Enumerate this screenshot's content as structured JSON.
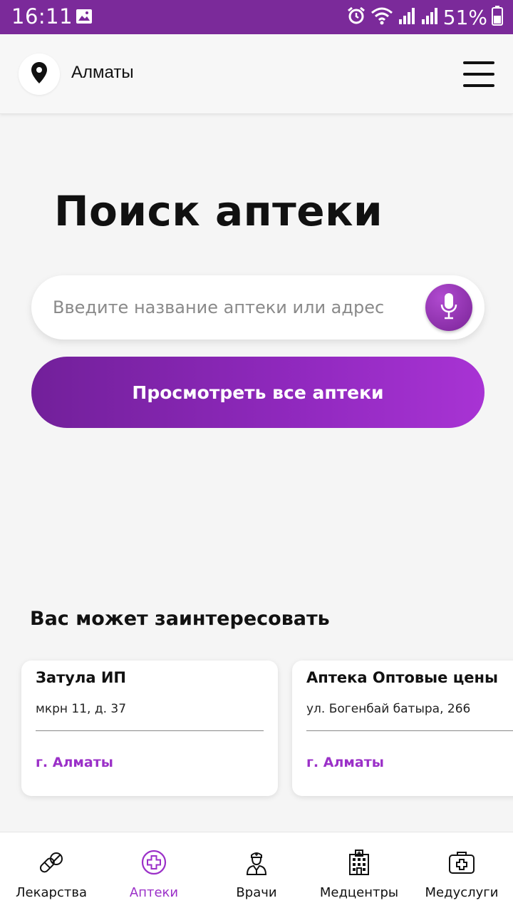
{
  "status_bar": {
    "time": "16:11",
    "battery": "51%",
    "icons": [
      "gallery-icon",
      "alarm-icon",
      "wifi-icon",
      "signal-icon",
      "signal-icon",
      "battery-icon"
    ],
    "background": "#7b2a9a"
  },
  "header": {
    "location_icon": "location-pin-icon",
    "city": "Алматы",
    "menu_icon": "hamburger-menu-icon"
  },
  "main": {
    "title": "Поиск аптеки",
    "search": {
      "placeholder": "Введите название аптеки или адрес",
      "value": "",
      "mic_icon": "microphone-icon"
    },
    "view_all_label": "Просмотреть все аптеки"
  },
  "recommendations": {
    "heading": "Вас может заинтересовать",
    "cards": [
      {
        "name": "Затула ИП",
        "address": "мкрн 11, д. 37",
        "city": "г. Алматы"
      },
      {
        "name": "Аптека Оптовые цены",
        "address": "ул. Богенбай батыра, 266",
        "city": "г. Алматы"
      }
    ]
  },
  "bottom_nav": {
    "items": [
      {
        "label": "Лекарства",
        "icon": "pills-icon",
        "active": false
      },
      {
        "label": "Аптеки",
        "icon": "pharmacy-cross-icon",
        "active": true
      },
      {
        "label": "Врачи",
        "icon": "doctor-icon",
        "active": false
      },
      {
        "label": "Медцентры",
        "icon": "hospital-building-icon",
        "active": false
      },
      {
        "label": "Медуслуги",
        "icon": "medical-kit-icon",
        "active": false
      }
    ]
  },
  "colors": {
    "accent": "#9b30c8",
    "button_gradient_start": "#72209a",
    "button_gradient_end": "#a833d4"
  }
}
